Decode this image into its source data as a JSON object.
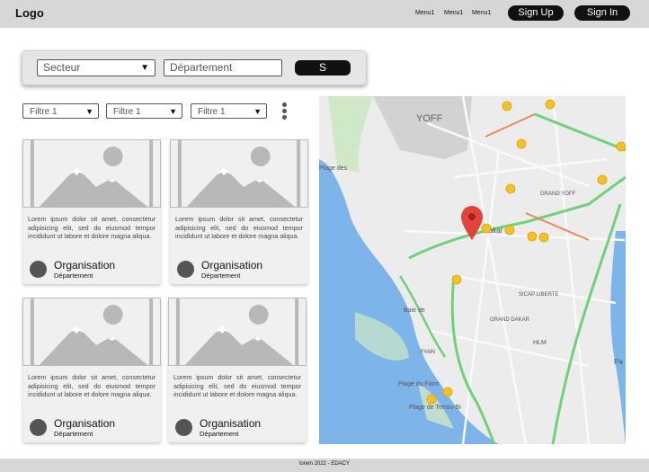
{
  "header": {
    "logo": "Logo",
    "menus": [
      "Menu1",
      "Menu1",
      "Menu1"
    ],
    "signup": "Sign Up",
    "signin": "Sign In"
  },
  "search": {
    "secteur": "Secteur",
    "departement_placeholder": "Département",
    "button": "S"
  },
  "filters": [
    "Filtre 1",
    "Filtre 1",
    "Filtre 1"
  ],
  "cards": [
    {
      "text": "Lorem ipsum dolor sit amet, consectetur adipisicing elit, sed do eiusmod tempor incididunt ut labore et dolore magna aliqua.",
      "org": "Organisation",
      "dept": "Département"
    },
    {
      "text": "Lorem ipsum dolor sit amet, consectetur adipisicing elit, sed do eiusmod tempor incididunt ut labore et dolore magna aliqua.",
      "org": "Organisation",
      "dept": "Département"
    },
    {
      "text": "Lorem ipsum dolor sit amet, consectetur adipisicing elit, sed do eiusmod tempor incididunt ut labore et dolore magna aliqua.",
      "org": "Organisation",
      "dept": "Département"
    },
    {
      "text": "Lorem ipsum dolor sit amet, consectetur adipisicing elit, sed do eiusmod tempor incididunt ut labore et dolore magna aliqua.",
      "org": "Organisation",
      "dept": "Département"
    }
  ],
  "map": {
    "labels": [
      "YOFF",
      "Plage des",
      "GRAND YOFF",
      "Dakar",
      "SICAP LIBERTE",
      "Baie de",
      "GRAND DAKAR",
      "HLM",
      "FANN",
      "Plage du Fann",
      "Plage de Terrou-Bi",
      "Pa"
    ],
    "marker_color": "#e0443b",
    "pin_color": "#f5c023"
  },
  "footer": "lorem 2022 - EDACY"
}
